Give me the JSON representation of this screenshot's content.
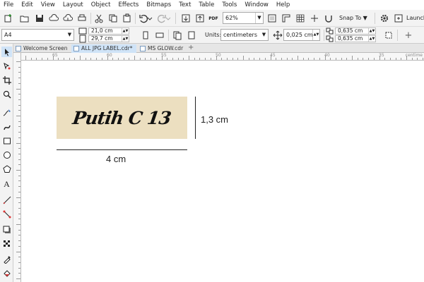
{
  "menu": [
    "File",
    "Edit",
    "View",
    "Layout",
    "Object",
    "Effects",
    "Bitmaps",
    "Text",
    "Table",
    "Tools",
    "Window",
    "Help"
  ],
  "toolbar": {
    "pdf_label": "PDF",
    "zoom": "62%",
    "snap_label": "Snap To",
    "launch_label": "Launch"
  },
  "property_bar": {
    "page_size": "A4",
    "page_width": "21,0 cm",
    "page_height": "29,7 cm",
    "units_label": "Units:",
    "units_value": "centimeters",
    "nudge": "0,025 cm",
    "dup_x": "0,635 cm",
    "dup_y": "0,635 cm"
  },
  "tabs": [
    {
      "label": "Welcome Screen",
      "active": false
    },
    {
      "label": "ALL JPG LABEL.cdr*",
      "active": true
    },
    {
      "label": "MS GLOW.cdr",
      "active": false
    }
  ],
  "ruler": {
    "numbers": [
      "65",
      "60",
      "55",
      "50",
      "45",
      "40",
      "35"
    ],
    "unit_label": "centime"
  },
  "canvas": {
    "label_text": "Putih C 13",
    "label_color": "#ecdfc0",
    "width_dimension": "4 cm",
    "height_dimension": "1,3 cm"
  },
  "icons": {
    "toolbox": [
      "pick-tool-icon",
      "shape-tool-icon",
      "crop-tool-icon",
      "zoom-tool-icon",
      "freehand-tool-icon",
      "artistic-media-icon",
      "rectangle-tool-icon",
      "ellipse-tool-icon",
      "polygon-tool-icon",
      "text-tool-icon",
      "parallel-dimension-icon",
      "connector-tool-icon",
      "drop-shadow-icon",
      "transparency-icon",
      "eyedropper-icon",
      "fill-tool-icon"
    ]
  }
}
